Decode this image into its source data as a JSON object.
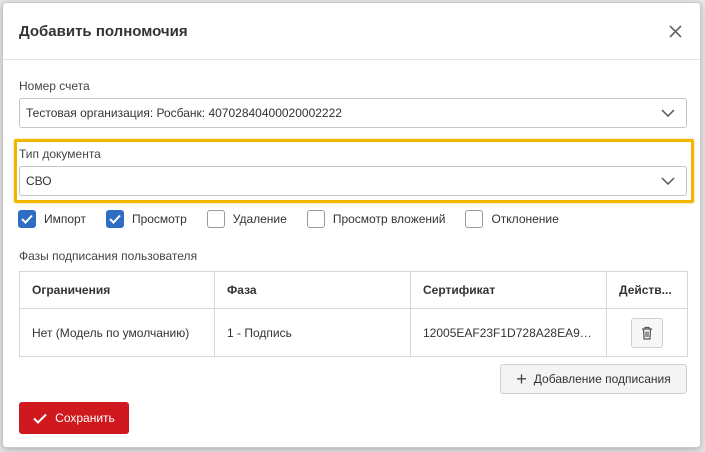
{
  "dialog": {
    "title": "Добавить полномочия"
  },
  "account": {
    "label": "Номер счета",
    "value": "Тестовая организация: Росбанк: 40702840400020002222"
  },
  "doc_type": {
    "label": "Тип документа",
    "value": "СВО"
  },
  "permissions": [
    {
      "label": "Импорт",
      "checked": true
    },
    {
      "label": "Просмотр",
      "checked": true
    },
    {
      "label": "Удаление",
      "checked": false
    },
    {
      "label": "Просмотр вложений",
      "checked": false
    },
    {
      "label": "Отклонение",
      "checked": false
    }
  ],
  "phases": {
    "section_label": "Фазы подписания пользователя",
    "columns": [
      "Ограничения",
      "Фаза",
      "Сертификат",
      "Действ..."
    ],
    "rows": [
      [
        "Нет (Модель по умолчанию)",
        "1 - Подпись",
        "12005EAF23F1D728A28EA9E3..."
      ]
    ]
  },
  "buttons": {
    "add_signing": "Добавление подписания",
    "save": "Сохранить"
  },
  "colors": {
    "accent": "#2d6ec4",
    "highlight": "#f2b600",
    "save": "#d0191f"
  }
}
